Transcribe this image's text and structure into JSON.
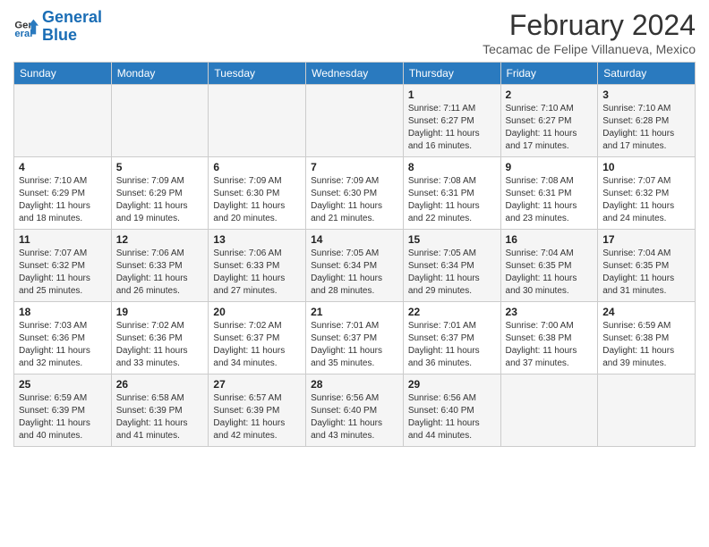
{
  "logo": {
    "line1": "General",
    "line2": "Blue"
  },
  "title": "February 2024",
  "subtitle": "Tecamac de Felipe Villanueva, Mexico",
  "days_of_week": [
    "Sunday",
    "Monday",
    "Tuesday",
    "Wednesday",
    "Thursday",
    "Friday",
    "Saturday"
  ],
  "weeks": [
    [
      {
        "day": "",
        "info": ""
      },
      {
        "day": "",
        "info": ""
      },
      {
        "day": "",
        "info": ""
      },
      {
        "day": "",
        "info": ""
      },
      {
        "day": "1",
        "info": "Sunrise: 7:11 AM\nSunset: 6:27 PM\nDaylight: 11 hours and 16 minutes."
      },
      {
        "day": "2",
        "info": "Sunrise: 7:10 AM\nSunset: 6:27 PM\nDaylight: 11 hours and 17 minutes."
      },
      {
        "day": "3",
        "info": "Sunrise: 7:10 AM\nSunset: 6:28 PM\nDaylight: 11 hours and 17 minutes."
      }
    ],
    [
      {
        "day": "4",
        "info": "Sunrise: 7:10 AM\nSunset: 6:29 PM\nDaylight: 11 hours and 18 minutes."
      },
      {
        "day": "5",
        "info": "Sunrise: 7:09 AM\nSunset: 6:29 PM\nDaylight: 11 hours and 19 minutes."
      },
      {
        "day": "6",
        "info": "Sunrise: 7:09 AM\nSunset: 6:30 PM\nDaylight: 11 hours and 20 minutes."
      },
      {
        "day": "7",
        "info": "Sunrise: 7:09 AM\nSunset: 6:30 PM\nDaylight: 11 hours and 21 minutes."
      },
      {
        "day": "8",
        "info": "Sunrise: 7:08 AM\nSunset: 6:31 PM\nDaylight: 11 hours and 22 minutes."
      },
      {
        "day": "9",
        "info": "Sunrise: 7:08 AM\nSunset: 6:31 PM\nDaylight: 11 hours and 23 minutes."
      },
      {
        "day": "10",
        "info": "Sunrise: 7:07 AM\nSunset: 6:32 PM\nDaylight: 11 hours and 24 minutes."
      }
    ],
    [
      {
        "day": "11",
        "info": "Sunrise: 7:07 AM\nSunset: 6:32 PM\nDaylight: 11 hours and 25 minutes."
      },
      {
        "day": "12",
        "info": "Sunrise: 7:06 AM\nSunset: 6:33 PM\nDaylight: 11 hours and 26 minutes."
      },
      {
        "day": "13",
        "info": "Sunrise: 7:06 AM\nSunset: 6:33 PM\nDaylight: 11 hours and 27 minutes."
      },
      {
        "day": "14",
        "info": "Sunrise: 7:05 AM\nSunset: 6:34 PM\nDaylight: 11 hours and 28 minutes."
      },
      {
        "day": "15",
        "info": "Sunrise: 7:05 AM\nSunset: 6:34 PM\nDaylight: 11 hours and 29 minutes."
      },
      {
        "day": "16",
        "info": "Sunrise: 7:04 AM\nSunset: 6:35 PM\nDaylight: 11 hours and 30 minutes."
      },
      {
        "day": "17",
        "info": "Sunrise: 7:04 AM\nSunset: 6:35 PM\nDaylight: 11 hours and 31 minutes."
      }
    ],
    [
      {
        "day": "18",
        "info": "Sunrise: 7:03 AM\nSunset: 6:36 PM\nDaylight: 11 hours and 32 minutes."
      },
      {
        "day": "19",
        "info": "Sunrise: 7:02 AM\nSunset: 6:36 PM\nDaylight: 11 hours and 33 minutes."
      },
      {
        "day": "20",
        "info": "Sunrise: 7:02 AM\nSunset: 6:37 PM\nDaylight: 11 hours and 34 minutes."
      },
      {
        "day": "21",
        "info": "Sunrise: 7:01 AM\nSunset: 6:37 PM\nDaylight: 11 hours and 35 minutes."
      },
      {
        "day": "22",
        "info": "Sunrise: 7:01 AM\nSunset: 6:37 PM\nDaylight: 11 hours and 36 minutes."
      },
      {
        "day": "23",
        "info": "Sunrise: 7:00 AM\nSunset: 6:38 PM\nDaylight: 11 hours and 37 minutes."
      },
      {
        "day": "24",
        "info": "Sunrise: 6:59 AM\nSunset: 6:38 PM\nDaylight: 11 hours and 39 minutes."
      }
    ],
    [
      {
        "day": "25",
        "info": "Sunrise: 6:59 AM\nSunset: 6:39 PM\nDaylight: 11 hours and 40 minutes."
      },
      {
        "day": "26",
        "info": "Sunrise: 6:58 AM\nSunset: 6:39 PM\nDaylight: 11 hours and 41 minutes."
      },
      {
        "day": "27",
        "info": "Sunrise: 6:57 AM\nSunset: 6:39 PM\nDaylight: 11 hours and 42 minutes."
      },
      {
        "day": "28",
        "info": "Sunrise: 6:56 AM\nSunset: 6:40 PM\nDaylight: 11 hours and 43 minutes."
      },
      {
        "day": "29",
        "info": "Sunrise: 6:56 AM\nSunset: 6:40 PM\nDaylight: 11 hours and 44 minutes."
      },
      {
        "day": "",
        "info": ""
      },
      {
        "day": "",
        "info": ""
      }
    ]
  ]
}
